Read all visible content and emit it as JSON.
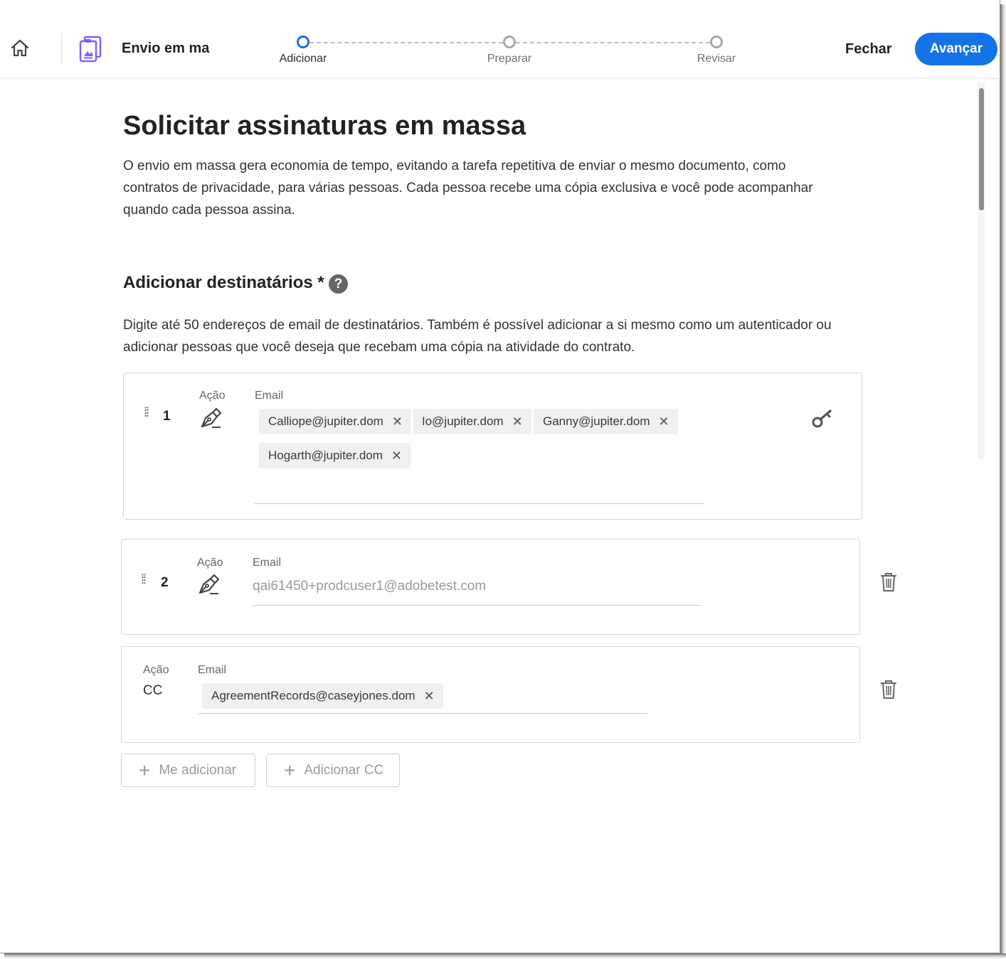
{
  "header": {
    "title": "Envio em ma",
    "home_icon": "home-icon",
    "document_icon": "clipboard-document-icon",
    "close_label": "Fechar",
    "next_label": "Avançar",
    "accent_color": "#1473e6"
  },
  "steps": [
    {
      "label": "Adicionar",
      "active": true
    },
    {
      "label": "Preparar",
      "active": false
    },
    {
      "label": "Revisar",
      "active": false
    }
  ],
  "main": {
    "title": "Solicitar assinaturas em massa",
    "intro": "O envio em massa gera economia de tempo, evitando a tarefa repetitiva de enviar o mesmo documento, como contratos de privacidade, para várias pessoas. Cada pessoa recebe uma cópia exclusiva e você pode acompanhar quando cada pessoa assina.",
    "recipients_title": "Adicionar destinatários *",
    "help_symbol": "?",
    "recipients_desc": "Digite até 50 endereços de email de destinatários. Também é possível adicionar a si mesmo como um autenticador ou adicionar pessoas que você deseja que recebam uma cópia na atividade do contrato."
  },
  "recipients": [
    {
      "number": "1",
      "action_label": "Ação",
      "email_label": "Email",
      "action_icon": "pen-sign-icon",
      "emails": [
        "Calliope@jupiter.dom",
        "Io@jupiter.dom",
        "Ganny@jupiter.dom",
        "Hogarth@jupiter.dom"
      ],
      "side_icon": "key-icon"
    },
    {
      "number": "2",
      "action_label": "Ação",
      "email_label": "Email",
      "action_icon": "pen-sign-icon",
      "placeholder": "qai61450+prodcuser1@adobetest.com",
      "side_icon": "trash-icon"
    }
  ],
  "cc": {
    "action_label": "Ação",
    "action_value": "CC",
    "email_label": "Email",
    "emails": [
      "AgreementRecords@caseyjones.dom"
    ],
    "side_icon": "trash-icon"
  },
  "buttons": {
    "add_me": "Me adicionar",
    "add_cc": "Adicionar CC"
  }
}
